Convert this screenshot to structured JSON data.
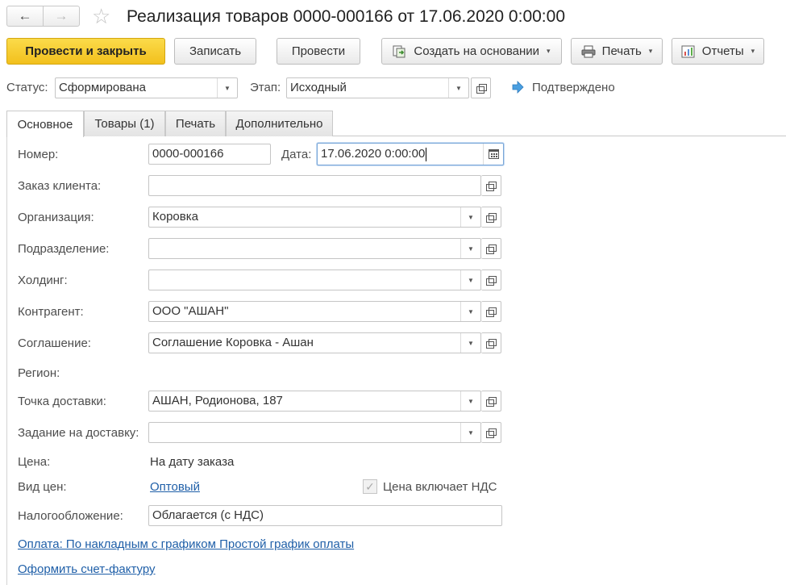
{
  "window": {
    "title": "Реализация товаров 0000-000166 от 17.06.2020 0:00:00"
  },
  "nav": {
    "back_icon": "←",
    "forward_icon": "→",
    "favorite_icon": "☆"
  },
  "toolbar": {
    "post_and_close": "Провести и закрыть",
    "write": "Записать",
    "post": "Провести",
    "create_based_on": "Создать на основании",
    "print": "Печать",
    "reports": "Отчеты",
    "caret": "▾"
  },
  "status_row": {
    "status_label": "Статус:",
    "status_value": "Сформирована",
    "stage_label": "Этап:",
    "stage_value": "Исходный",
    "approved_text": "Подтверждено"
  },
  "tabs": [
    {
      "label": "Основное"
    },
    {
      "label": "Товары (1)"
    },
    {
      "label": "Печать"
    },
    {
      "label": "Дополнительно"
    }
  ],
  "form": {
    "number_label": "Номер:",
    "number_value": "0000-000166",
    "date_label": "Дата:",
    "date_value": "17.06.2020  0:00:00",
    "client_order_label": "Заказ клиента:",
    "client_order_value": "",
    "organization_label": "Организация:",
    "organization_value": "Коровка",
    "department_label": "Подразделение:",
    "department_value": "",
    "holding_label": "Холдинг:",
    "holding_value": "",
    "counterparty_label": "Контрагент:",
    "counterparty_value": "ООО \"АШАН\"",
    "agreement_label": "Соглашение:",
    "agreement_value": "Соглашение Коровка - Ашан",
    "region_label": "Регион:",
    "delivery_point_label": "Точка доставки:",
    "delivery_point_value": "АШАН, Родионова, 187",
    "delivery_task_label": "Задание на доставку:",
    "delivery_task_value": "",
    "price_label": "Цена:",
    "price_value": "На дату заказа",
    "price_type_label": "Вид цен:",
    "price_type_value": "Оптовый",
    "vat_included_label": "Цена включает НДС",
    "vat_included_checked": true,
    "taxation_label": "Налогообложение:",
    "taxation_value": "Облагается (с НДС)",
    "payment_link": "Оплата: По накладным с графиком Простой график оплаты",
    "invoice_link": "Оформить счет-фактуру"
  }
}
